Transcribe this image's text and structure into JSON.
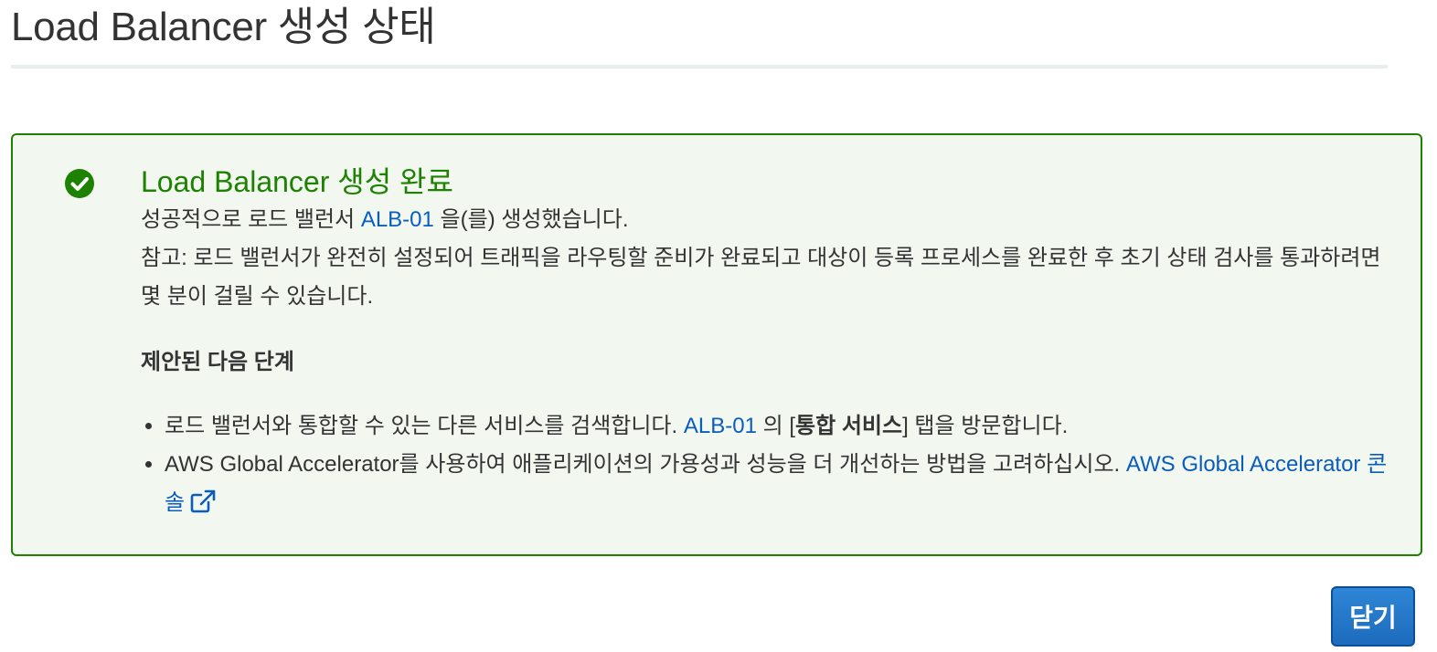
{
  "page": {
    "title": "Load Balancer 생성 상태"
  },
  "alert": {
    "status": "success",
    "icon": "check-circle-icon",
    "accent_color": "#1d8102",
    "title": "Load Balancer 생성 완료",
    "message": {
      "prefix": "성공적으로 로드 밸런서 ",
      "lb_name": "ALB-01",
      "suffix": " 을(를) 생성했습니다."
    },
    "note": "참고: 로드 밸런서가 완전히 설정되어 트래픽을 라우팅할 준비가 완료되고 대상이 등록 프로세스를 완료한 후 초기 상태 검사를 통과하려면 몇 분이 걸릴 수 있습니다."
  },
  "next_steps": {
    "heading": "제안된 다음 단계",
    "items": [
      {
        "text": "로드 밸런서와 통합할 수 있는 다른 서비스를 검색합니다. ",
        "link": "ALB-01",
        "middle": " 의 [",
        "bold": "통합 서비스",
        "suffix": "] 탭을 방문합니다."
      },
      {
        "text": "AWS Global Accelerator를 사용하여 애플리케이션의 가용성과 성능을 더 개선하는 방법을 고려하십시오. ",
        "link": "AWS Global Accelerator 콘솔",
        "link_icon": "external-link-icon"
      }
    ]
  },
  "footer": {
    "close_label": "닫기",
    "button_color": "#1d6bbd"
  }
}
